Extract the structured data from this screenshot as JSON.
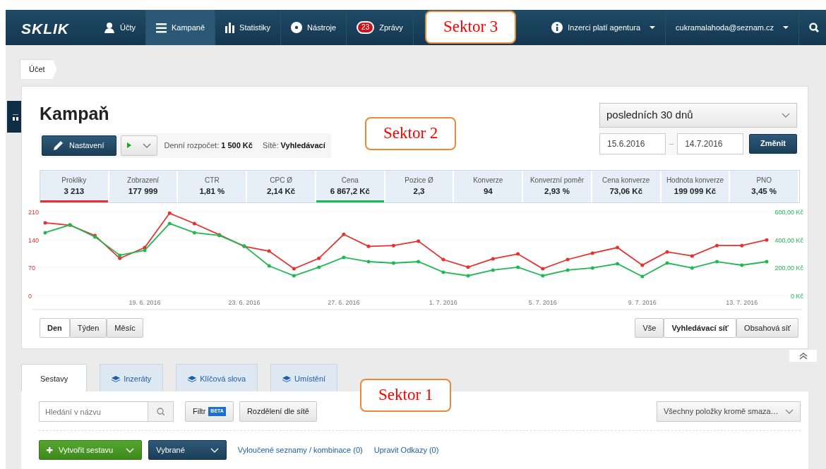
{
  "navbar": {
    "logo": "SKLIK",
    "items": [
      {
        "label": "Účty",
        "selected": false
      },
      {
        "label": "Kampaně",
        "selected": true
      },
      {
        "label": "Statistiky",
        "selected": false
      },
      {
        "label": "Nástroje",
        "selected": false
      },
      {
        "label": "Zprávy",
        "badge": "23",
        "selected": false
      }
    ],
    "right": [
      {
        "label": "Inzerci platí agentura",
        "kind": "info"
      },
      {
        "label": "cukramalahoda@seznam.cz",
        "kind": "user"
      }
    ]
  },
  "breadcrumb": [
    "Účet"
  ],
  "campaign": {
    "title": "Kampaň",
    "settings_button": "Nastavení",
    "budget_label": "Denní rozpočet:",
    "budget_value": "1 500 Kč",
    "networks_label": "Sítě:",
    "networks_value": "Vyhledávací"
  },
  "date_range": {
    "preset": "posledních 30 dnů",
    "from": "15.6.2016",
    "separator": "–",
    "to": "14.7.2016",
    "button": "Změnit"
  },
  "metrics": [
    {
      "label": "Prokliky",
      "value": "3 213",
      "selected": true,
      "color": "#e8312f"
    },
    {
      "label": "Zobrazení",
      "value": "177 999",
      "selected": false
    },
    {
      "label": "CTR",
      "value": "1,81 %",
      "selected": false
    },
    {
      "label": "CPC Ø",
      "value": "2,14 Kč",
      "selected": false
    },
    {
      "label": "Cena",
      "value": "6 867,2 Kč",
      "selected": true,
      "color": "#1fb954"
    },
    {
      "label": "Pozice Ø",
      "value": "2,3",
      "selected": false
    },
    {
      "label": "Konverze",
      "value": "94",
      "selected": false
    },
    {
      "label": "Konverzní poměr",
      "value": "2,93 %",
      "selected": false
    },
    {
      "label": "Cena konverze",
      "value": "73,06 Kč",
      "selected": false
    },
    {
      "label": "Hodnota konverze",
      "value": "199 099 Kč",
      "selected": false
    },
    {
      "label": "PNO",
      "value": "3,45 %",
      "selected": false
    }
  ],
  "chart": {
    "left_axis": {
      "chart_data": {
        "type": "line",
        "categories": [
          null,
          null,
          null,
          null,
          "19. 6. 2016",
          null,
          null,
          null,
          "23. 6. 2016",
          null,
          null,
          null,
          "27. 6. 2016",
          null,
          null,
          null,
          "1. 7. 2016",
          null,
          null,
          null,
          "5. 7. 2016",
          null,
          null,
          null,
          "9. 7. 2016",
          null,
          null,
          null,
          "13. 7. 2016",
          null
        ],
        "yticks": [
          0,
          70,
          140,
          210
        ],
        "ylim": [
          0,
          210
        ],
        "series": [
          {
            "color": "#e8312f",
            "values": [
              182,
              176,
              150,
              93,
              120,
              206,
              180,
              152,
              123,
              111,
              67,
              93,
              153,
              123,
              125,
              136,
              90,
              71,
              92,
              104,
              67,
              90,
              106,
              120,
              76,
              109,
              99,
              125,
              125,
              139
            ]
          }
        ]
      }
    },
    "right_axis": {
      "chart_data": {
        "type": "line",
        "categories": [
          null,
          null,
          null,
          null,
          null,
          null,
          null,
          null,
          null,
          null,
          null,
          null,
          null,
          null,
          null,
          null,
          null,
          null,
          null,
          null,
          null,
          null,
          null,
          null,
          null,
          null,
          null,
          null,
          null,
          null
        ],
        "yticks": [
          {
            "value": 0,
            "label": "0 Kč"
          },
          {
            "value": 200,
            "label": "200,00 Kč"
          },
          {
            "value": 400,
            "label": "400,00 Kč"
          },
          {
            "value": 600,
            "label": "600,00 Kč"
          }
        ],
        "ylim": [
          0,
          600
        ],
        "series": [
          {
            "color": "#1fb954",
            "values": [
              449,
              505,
              419,
              288,
              323,
              515,
              449,
              429,
              354,
              212,
              141,
              202,
              273,
              242,
              232,
              242,
              167,
              141,
              182,
              202,
              141,
              182,
              197,
              227,
              136,
              232,
              197,
              242,
              217,
              242
            ]
          }
        ]
      }
    }
  },
  "granularity": [
    {
      "label": "Den",
      "selected": true
    },
    {
      "label": "Týden",
      "selected": false
    },
    {
      "label": "Měsíc",
      "selected": false
    }
  ],
  "network_filter": [
    {
      "label": "Vše",
      "selected": false
    },
    {
      "label": "Vyhledávací síť",
      "selected": true
    },
    {
      "label": "Obsahová síť",
      "selected": false
    }
  ],
  "section_tabs": [
    {
      "label": "Sestavy",
      "selected": true
    },
    {
      "label": "Inzeráty",
      "selected": false
    },
    {
      "label": "Klíčová slova",
      "selected": false
    },
    {
      "label": "Umístění",
      "selected": false
    }
  ],
  "toolbar": {
    "search_placeholder": "Hledání v názvu",
    "filter_button": "Filtr",
    "filter_badge": "BETA",
    "split_button": "Rozdělení dle sítě",
    "items_select": "Všechny položky kromě smaza…"
  },
  "actions": {
    "create_button": "Vytvořit sestavu",
    "selected_button": "Vybrané",
    "links": [
      "Vyloučené seznamy / kombinace (0)",
      "Upravit Odkazy (0)"
    ]
  },
  "annotations": [
    "Sektor 3",
    "Sektor 2",
    "Sektor 1"
  ]
}
